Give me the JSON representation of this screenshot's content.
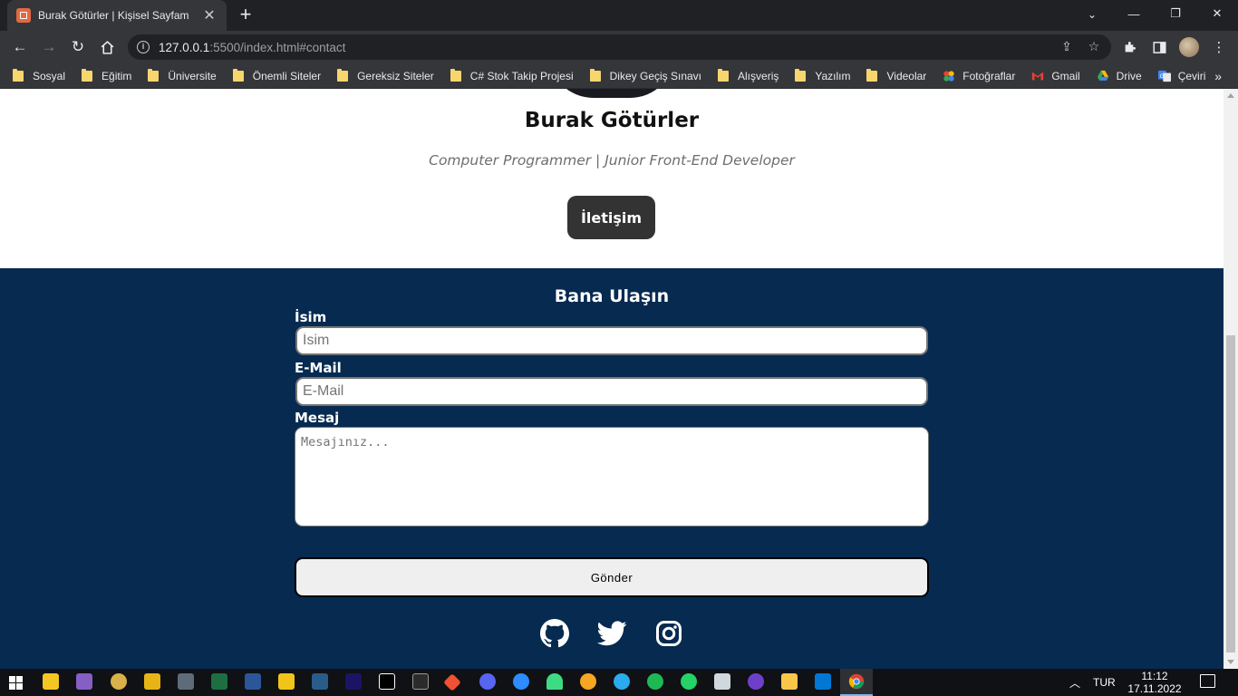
{
  "browser": {
    "tab_title": "Burak Götürler | Kişisel Sayfam",
    "url_host": "127.0.0.1",
    "url_rest": ":5500/index.html#contact",
    "bookmarks": [
      {
        "label": "Sosyal",
        "icon": "folder-icon"
      },
      {
        "label": "Eğitim",
        "icon": "folder-icon"
      },
      {
        "label": "Üniversite",
        "icon": "folder-icon"
      },
      {
        "label": "Önemli Siteler",
        "icon": "folder-icon"
      },
      {
        "label": "Gereksiz Siteler",
        "icon": "folder-icon"
      },
      {
        "label": "C# Stok Takip Projesi",
        "icon": "folder-icon"
      },
      {
        "label": "Dikey Geçiş Sınavı",
        "icon": "folder-icon"
      },
      {
        "label": "Alışveriş",
        "icon": "folder-icon"
      },
      {
        "label": "Yazılım",
        "icon": "folder-icon"
      },
      {
        "label": "Videolar",
        "icon": "folder-icon"
      },
      {
        "label": "Fotoğraflar",
        "icon": "google-photos-icon"
      },
      {
        "label": "Gmail",
        "icon": "gmail-icon"
      },
      {
        "label": "Drive",
        "icon": "google-drive-icon"
      },
      {
        "label": "Çeviri",
        "icon": "google-translate-icon"
      }
    ],
    "bookmarks_more": "»"
  },
  "hero": {
    "name": "Burak Götürler",
    "subtitle": "Computer Programmer | Junior Front-End Developer",
    "button_label": "İletişim"
  },
  "contact": {
    "title": "Bana Ulaşın",
    "name_label": "İsim",
    "name_placeholder": "İsim",
    "email_label": "E-Mail",
    "email_placeholder": "E-Mail",
    "message_label": "Mesaj",
    "message_placeholder": "Mesajınız...",
    "submit_label": "Gönder"
  },
  "socials": [
    "github-icon",
    "twitter-icon",
    "instagram-icon"
  ],
  "taskbar": {
    "language": "TUR",
    "time": "11:12",
    "date": "17.11.2022"
  },
  "colors": {
    "contact_bg": "#062a50",
    "hero_button_bg": "#333333",
    "chrome_dark": "#35363a"
  }
}
